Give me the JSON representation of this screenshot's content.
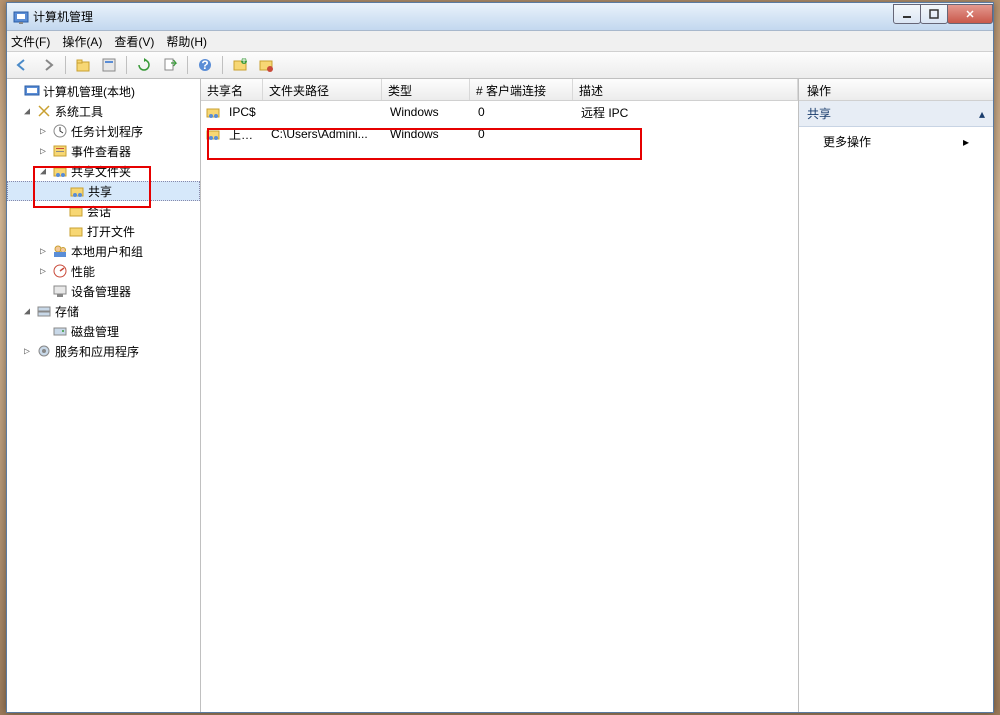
{
  "window": {
    "title": "计算机管理"
  },
  "menubar": [
    "文件(F)",
    "操作(A)",
    "查看(V)",
    "帮助(H)"
  ],
  "tree": {
    "root": "计算机管理(本地)",
    "system_tools": "系统工具",
    "task_scheduler": "任务计划程序",
    "event_viewer": "事件查看器",
    "shared_folders": "共享文件夹",
    "shares": "共享",
    "sessions": "会话",
    "open_files": "打开文件",
    "local_users": "本地用户和组",
    "performance": "性能",
    "device_manager": "设备管理器",
    "storage": "存储",
    "disk_mgmt": "磁盘管理",
    "services_apps": "服务和应用程序"
  },
  "list": {
    "columns": [
      "共享名",
      "文件夹路径",
      "类型",
      "# 客户端连接",
      "描述"
    ],
    "rows": [
      {
        "name": "IPC$",
        "path": "",
        "type": "Windows",
        "connections": "0",
        "desc": "远程 IPC"
      },
      {
        "name": "上传前",
        "path": "C:\\Users\\Admini...",
        "type": "Windows",
        "connections": "0",
        "desc": ""
      }
    ]
  },
  "actions": {
    "header": "操作",
    "section": "共享",
    "more": "更多操作"
  }
}
